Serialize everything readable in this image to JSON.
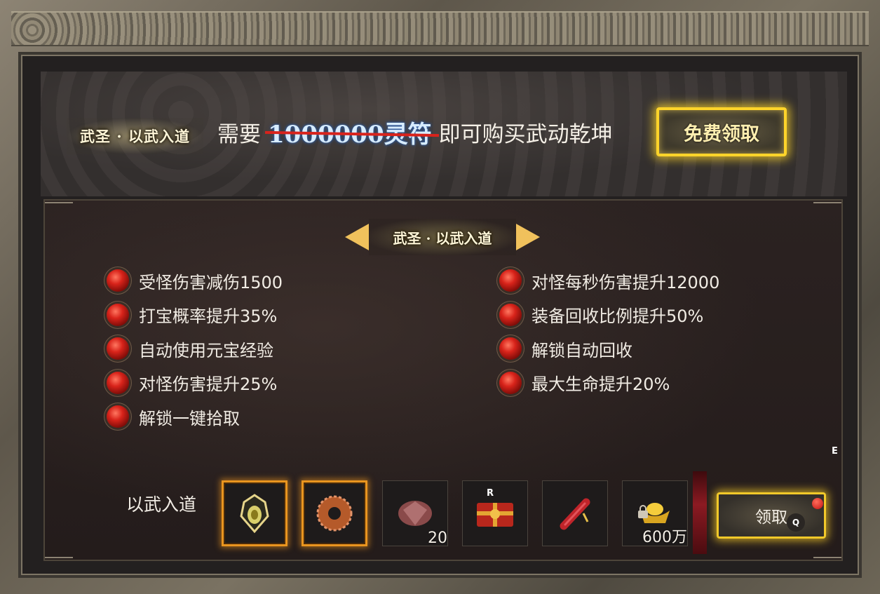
{
  "banner": {
    "title": "武圣 · 以武入道",
    "need_text": "需要",
    "old_price": "1000000灵符",
    "suffix_text": "即可购买武动乾坤",
    "free_button": "免费领取"
  },
  "section": {
    "title": "武圣 · 以武入道"
  },
  "attributes_left": [
    "受怪伤害减伤1500",
    "打宝概率提升35%",
    "自动使用元宝经验",
    "对怪伤害提升25%",
    "解锁一键拾取"
  ],
  "attributes_right": [
    "对怪每秒伤害提升12000",
    "装备回收比例提升50%",
    "解锁自动回收",
    "最大生命提升20%"
  ],
  "rewards": {
    "label": "以武入道",
    "items": [
      {
        "icon": "amulet-icon",
        "count": "",
        "key": "",
        "highlighted": true
      },
      {
        "icon": "ring-icon",
        "count": "",
        "key": "",
        "highlighted": true
      },
      {
        "icon": "gem-icon",
        "count": "20",
        "key": "",
        "highlighted": false
      },
      {
        "icon": "gift-box-icon",
        "count": "",
        "key": "R",
        "highlighted": false
      },
      {
        "icon": "scroll-icon",
        "count": "",
        "key": "",
        "highlighted": false
      },
      {
        "icon": "gold-ingot-icon",
        "count": "600万",
        "key": "",
        "highlighted": false
      }
    ],
    "claim_button": "领取",
    "claim_key": "Q",
    "edge_key": "E"
  },
  "colors": {
    "accent_gold": "#ffd42a",
    "strike_red": "#d8231c",
    "orb_red": "#d8231a"
  }
}
